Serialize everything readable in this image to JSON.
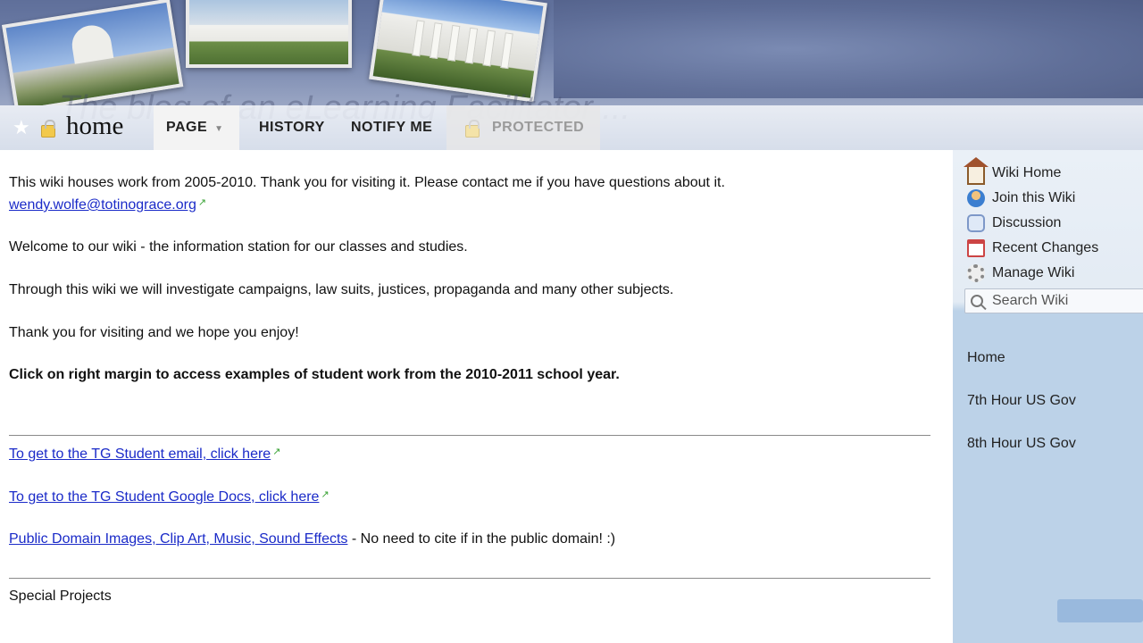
{
  "banner": {
    "blog_title": "The blog of an eLearning Facilitator ..."
  },
  "nav": {
    "page_title": "home",
    "tabs": [
      {
        "label": "PAGE"
      },
      {
        "label": "HISTORY"
      },
      {
        "label": "NOTIFY ME"
      },
      {
        "label": "PROTECTED"
      }
    ]
  },
  "content": {
    "intro": "This wiki houses work from 2005-2010. Thank you for visiting it. Please contact me if you have questions about it.",
    "email": "wendy.wolfe@totinograce.org",
    "welcome": "Welcome to our wiki - the information station for our classes and studies.",
    "investigate": "Through this wiki we will investigate campaigns, law suits, justices, propaganda and many other subjects.",
    "thanks": "Thank you for visiting and we hope you enjoy!",
    "click_note": "Click on right margin to access examples of student work from the 2010-2011 school year.",
    "links": [
      {
        "text": "To get to the TG Student email, click here"
      },
      {
        "text": "To get to the TG Student Google Docs, click here"
      },
      {
        "text": "Public Domain Images, Clip Art, Music, Sound Effects",
        "suffix": " - No need to cite if in the public domain! :)"
      }
    ],
    "special_projects": "Special Projects"
  },
  "sidebar": {
    "menu": [
      {
        "label": "Wiki Home",
        "icon": "home-icon"
      },
      {
        "label": "Join this Wiki",
        "icon": "user-icon"
      },
      {
        "label": "Discussion",
        "icon": "speech-bubble-icon"
      },
      {
        "label": "Recent Changes",
        "icon": "calendar-icon"
      },
      {
        "label": "Manage Wiki",
        "icon": "gear-icon"
      }
    ],
    "search_placeholder": "Search Wiki",
    "navigation": [
      {
        "label": "Home"
      },
      {
        "label": "7th Hour US Gov"
      },
      {
        "label": "8th Hour US Gov"
      }
    ]
  },
  "colors": {
    "link": "#1a2ac8",
    "sidebar_bg": "#bcd2e8",
    "external_link_icon": "#3aa335"
  }
}
